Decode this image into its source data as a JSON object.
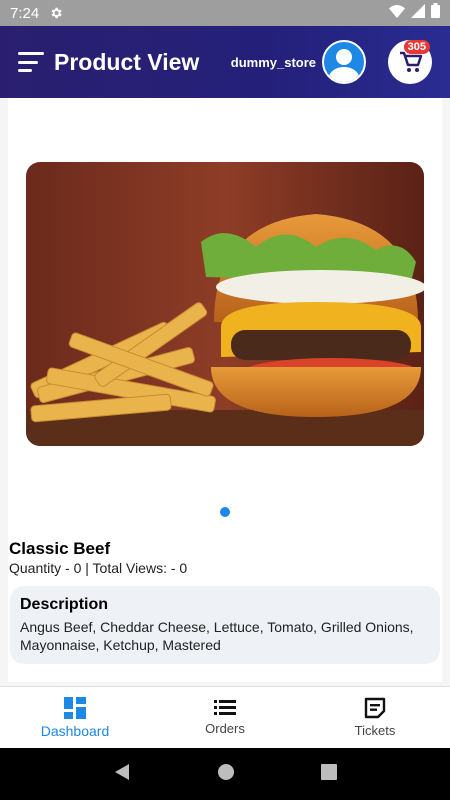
{
  "status_bar": {
    "time": "7:24"
  },
  "app_bar": {
    "title": "Product View",
    "store_name": "dummy_store",
    "cart_badge": "305"
  },
  "product": {
    "name": "Classic Beef",
    "stats": "Quantity - 0 | Total Views: - 0",
    "description_title": "Description",
    "description": "Angus Beef, Cheddar Cheese, Lettuce, Tomato, Grilled Onions, Mayonnaise, Ketchup, Mastered"
  },
  "bottom_nav": {
    "items": [
      {
        "label": "Dashboard",
        "icon": "dashboard-icon",
        "active": true
      },
      {
        "label": "Orders",
        "icon": "list-icon",
        "active": false
      },
      {
        "label": "Tickets",
        "icon": "ticket-icon",
        "active": false
      }
    ]
  },
  "colors": {
    "app_bar": "#24207a",
    "accent": "#1e88e5",
    "badge": "#e53935"
  }
}
